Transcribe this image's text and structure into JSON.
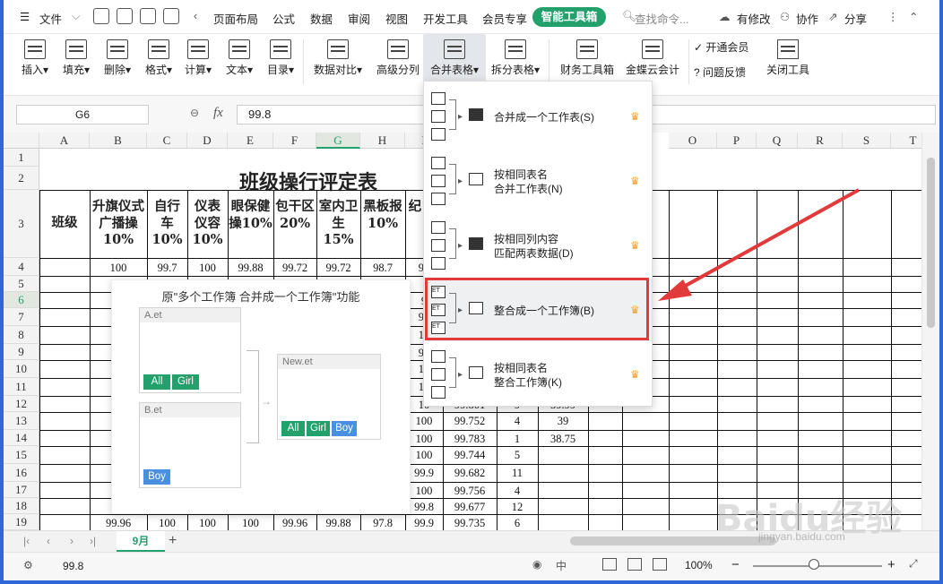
{
  "tabbar": {
    "file": "文件",
    "tabs": [
      "页面布局",
      "公式",
      "数据",
      "审阅",
      "视图",
      "开发工具",
      "会员专享"
    ],
    "active_tab": "智能工具箱",
    "search": "查找命令...",
    "changes": "有修改",
    "collab": "协作",
    "share": "分享"
  },
  "ribbon": {
    "buttons": [
      "插入",
      "填充",
      "删除",
      "格式",
      "计算",
      "文本",
      "目录",
      "数据对比",
      "高级分列",
      "合并表格",
      "拆分表格",
      "财务工具箱",
      "金蝶云会计"
    ],
    "vip": "开通会员",
    "feedback": "问题反馈",
    "close": "关闭工具"
  },
  "formula": {
    "cell_ref": "G6",
    "fx": "fx",
    "value": "99.8"
  },
  "columns": [
    "A",
    "B",
    "C",
    "D",
    "E",
    "F",
    "G",
    "H",
    "I",
    "O",
    "P",
    "Q",
    "R",
    "S",
    "T"
  ],
  "rows": [
    "1",
    "2",
    "3",
    "4",
    "5",
    "6",
    "7",
    "8",
    "9",
    "10",
    "11",
    "12",
    "13",
    "14",
    "15",
    "16",
    "17",
    "18",
    "19"
  ],
  "sheet": {
    "title": "班级操行评定表",
    "h_class": "班级",
    "headers": [
      "升旗仪式广播操10%",
      "自行车10%",
      "仪表仪容10%",
      "眼保健操10%",
      "包干区20%",
      "室内卫生15%",
      "黑板报10%",
      "纪15"
    ],
    "row4": [
      "100",
      "99.7",
      "100",
      "99.88",
      "99.72",
      "99.72",
      "98.7",
      "99"
    ],
    "left_vals": {
      "r7": "99",
      "r10": "9",
      "r11": "9",
      "r12": "9",
      "r16": "9",
      "r17": "9",
      "r18": "9"
    },
    "i_col": {
      "r6": "9",
      "r7": "99",
      "r8": "10",
      "r9": "99",
      "r10": "10",
      "r11": "10",
      "r12": "10",
      "r13": "100",
      "r14": "100",
      "r15": "100",
      "r16": "99.9",
      "r17": "100",
      "r18": "99.8",
      "r19": "99.9"
    },
    "j_col": {
      "r12": "99.801",
      "r13": "99.752",
      "r14": "99.783",
      "r15": "99.744",
      "r16": "99.682",
      "r17": "99.756",
      "r18": "99.677",
      "r19": "99.735"
    },
    "k_col": {
      "r12": "9",
      "r13": "4",
      "r14": "1",
      "r15": "5",
      "r16": "11",
      "r17": "4",
      "r18": "12",
      "r19": "6"
    },
    "l_col": {
      "r12": "39.99",
      "r13": "39",
      "r14": "38.75"
    },
    "row19": [
      "99.96",
      "100",
      "100",
      "100",
      "99.96",
      "99.88",
      "97.8"
    ]
  },
  "preview": {
    "title": "原\"多个工作簿 合并成一个工作簿\"功能",
    "a": "A.et",
    "b": "B.et",
    "new": "New.et",
    "tag_all": "All",
    "tag_girl": "Girl",
    "tag_boy": "Boy"
  },
  "menu": {
    "items": [
      {
        "label": "合并成一个工作表(S)"
      },
      {
        "label": "按相同表名",
        "label2": "合并工作表(N)"
      },
      {
        "label": "按相同列内容",
        "label2": "匹配两表数据(D)"
      },
      {
        "label": "整合成一个工作簿(B)"
      },
      {
        "label": "按相同表名",
        "label2": "整合工作簿(K)"
      }
    ],
    "crown": "♛",
    "et": "ET"
  },
  "sheettab": "9月",
  "status": {
    "value": "99.8",
    "zoom": "100%"
  },
  "watermark": {
    "text": "Baidu经验",
    "url": "jingyan.baidu.com"
  },
  "colors": {
    "accent": "#23a06c",
    "highlight": "#e23a3a",
    "frame": "#2f66d8",
    "tag_blue": "#4a8fe0"
  }
}
